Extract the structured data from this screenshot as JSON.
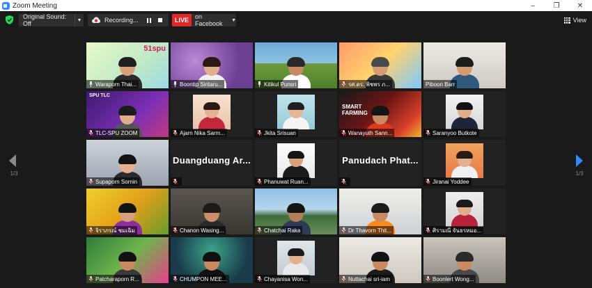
{
  "window": {
    "title": "Zoom Meeting",
    "controls": [
      "–",
      "❐",
      "✕"
    ]
  },
  "toolbar": {
    "original_sound": "Original Sound: Off",
    "recording": "Recording...",
    "live_badge": "LIVE",
    "live_destination": "on Facebook",
    "view_label": "View"
  },
  "pager": {
    "left": "1/3",
    "right": "1/3"
  },
  "colors": {
    "accent": "#2d8cff",
    "live": "#e02828",
    "active_speaker": "#e5e82c",
    "muted": "#e02828"
  },
  "participants": [
    {
      "name": "Waraporn Thai...",
      "pinned": true,
      "muted": false,
      "active": true
    },
    {
      "name": "Boontip Siritaru...",
      "pinned": true,
      "muted": false
    },
    {
      "name": "Kitikul Punsri",
      "pinned": true,
      "muted": false
    },
    {
      "name": "รศ.ดร. พิชพร ภ...",
      "pinned": true,
      "muted": true
    },
    {
      "name": "Piboon Barr",
      "pinned": false,
      "muted": false
    },
    {
      "name": "TLC-SPU ZOOM",
      "pinned": false,
      "muted": true
    },
    {
      "name": "Ajarn Nika Sarm...",
      "pinned": false,
      "muted": true
    },
    {
      "name": "Jkita Srisuan",
      "pinned": false,
      "muted": true
    },
    {
      "name": "Wanayuth Sann...",
      "pinned": false,
      "muted": true
    },
    {
      "name": "Saranyoo Butkote",
      "pinned": false,
      "muted": true
    },
    {
      "name": "Supaporn Sornin",
      "pinned": false,
      "muted": true
    },
    {
      "name": "",
      "big_name": "Duangduang Ar...",
      "pinned": false,
      "muted": true
    },
    {
      "name": "Phanuwat Ruan...",
      "pinned": false,
      "muted": true
    },
    {
      "name": "",
      "big_name": "Panudach Phat...",
      "pinned": false,
      "muted": true
    },
    {
      "name": "Jiranai Yoddee",
      "pinned": false,
      "muted": true
    },
    {
      "name": "จิราภรณ์ ชมเฉิม",
      "pinned": false,
      "muted": true
    },
    {
      "name": "Chanon Wasing...",
      "pinned": false,
      "muted": true
    },
    {
      "name": "Chatchai Raka",
      "pinned": false,
      "muted": true
    },
    {
      "name": "Dr Thavorn Thit...",
      "pinned": false,
      "muted": true
    },
    {
      "name": "ศิรามณี จันธรหมอ...",
      "pinned": false,
      "muted": true
    },
    {
      "name": "Patcharaporn R...",
      "pinned": false,
      "muted": true
    },
    {
      "name": "CHUMPON MEE...",
      "pinned": false,
      "muted": true
    },
    {
      "name": "Chayanisa Won...",
      "pinned": false,
      "muted": true
    },
    {
      "name": "Nuttachai sri-iam",
      "pinned": false,
      "muted": true
    },
    {
      "name": "Boonlert Wong...",
      "pinned": false,
      "muted": true
    }
  ],
  "tile_text": {
    "spu_logo": "51spu",
    "spu_tlc": "SPU TLC",
    "smart_farming": "SMART FARMING"
  }
}
